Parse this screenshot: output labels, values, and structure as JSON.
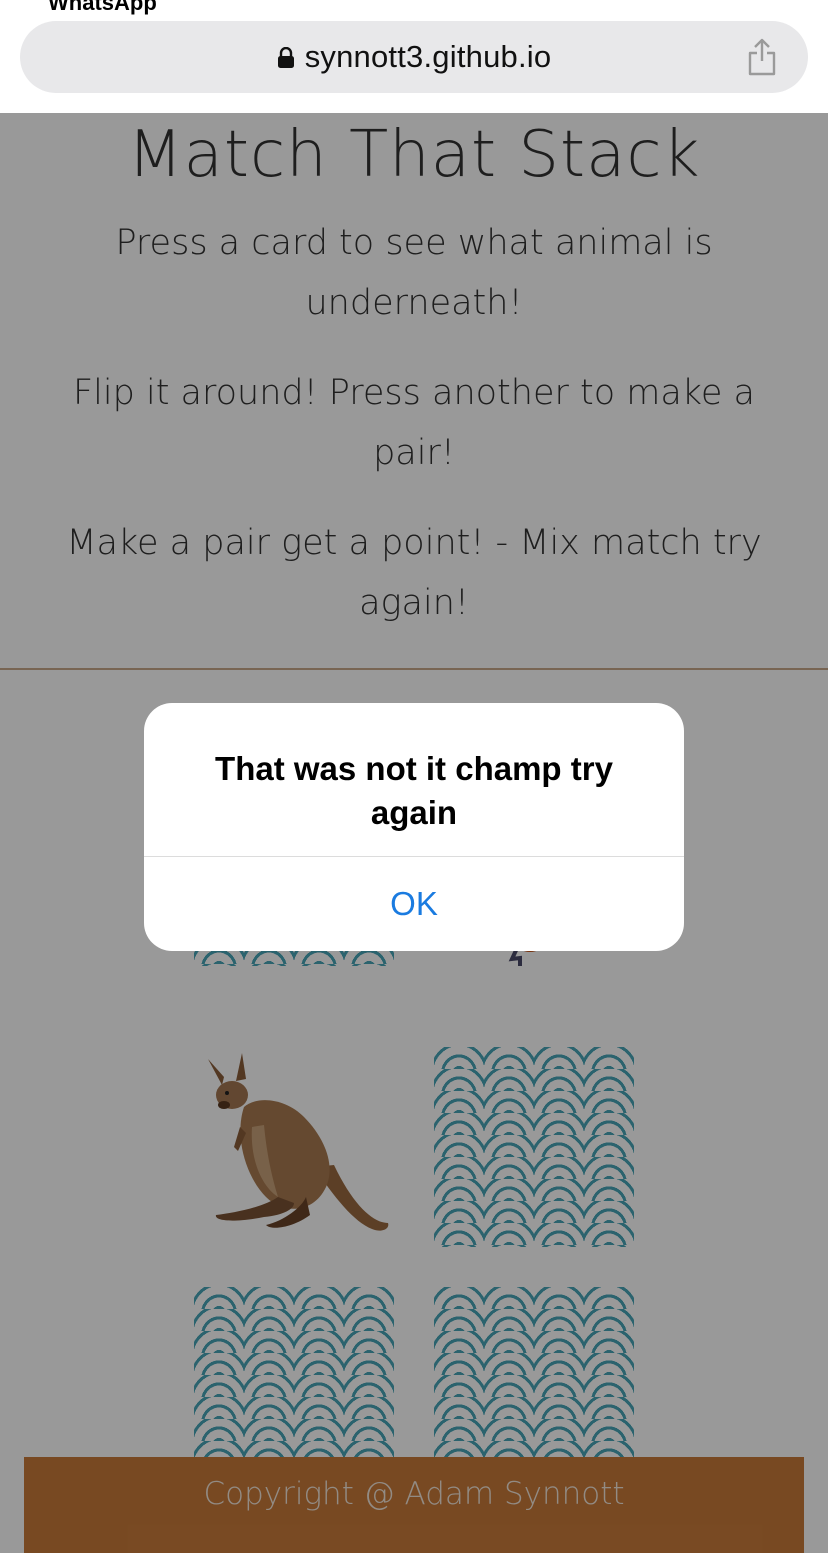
{
  "browser": {
    "url": "synnott3.github.io",
    "top_label": "WhatsApp"
  },
  "header": {
    "title": "Match That Stack",
    "instructions": [
      "Press a card to see what animal is underneath!",
      "Flip it around! Press another to make a pair!",
      "Make a pair get a point! - Mix match try again!"
    ]
  },
  "cards": [
    {
      "state": "face-down",
      "animal": ""
    },
    {
      "state": "face-up",
      "animal": "bird-icon"
    },
    {
      "state": "face-up",
      "animal": "kangaroo-icon"
    },
    {
      "state": "face-down",
      "animal": ""
    },
    {
      "state": "face-down",
      "animal": ""
    },
    {
      "state": "face-down",
      "animal": ""
    }
  ],
  "footer": {
    "text": "Copyright @ Adam Synnott"
  },
  "dialog": {
    "message": "That was not it champ try again",
    "ok_label": "OK"
  },
  "colors": {
    "footer": "#c97b3a",
    "card_pattern": "#48a5b7",
    "ok_button": "#1a7be0",
    "divider": "#c8a98a"
  }
}
